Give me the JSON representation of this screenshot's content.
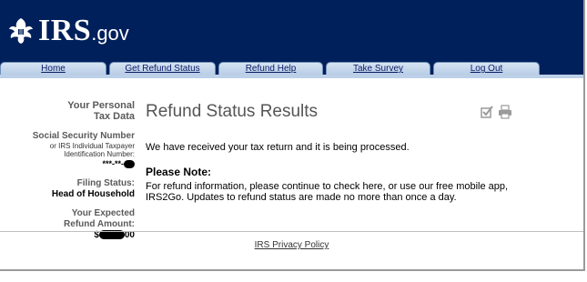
{
  "header": {
    "logo_irs": "IRS",
    "logo_gov": ".gov",
    "bg_color": "#00205b"
  },
  "tabs": [
    {
      "label": "Home"
    },
    {
      "label": "Get Refund Status"
    },
    {
      "label": "Refund Help"
    },
    {
      "label": "Take Survey"
    },
    {
      "label": "Log Out"
    }
  ],
  "sidebar": {
    "heading_line1": "Your Personal",
    "heading_line2": "Tax Data",
    "ssn_label": "Social Security Number",
    "ssn_sub1": "or IRS Individual Taxpayer",
    "ssn_sub2": "Identification Number:",
    "ssn_value": "***-**-",
    "filing_label": "Filing Status:",
    "filing_value": "Head of Household",
    "refund_label1": "Your Expected",
    "refund_label2": "Refund Amount:",
    "refund_prefix": "$",
    "refund_suffix": "00"
  },
  "main": {
    "title": "Refund Status Results",
    "message": "We have received your tax return and it is being processed.",
    "note_heading": "Please Note:",
    "note_text": "For refund information, please continue to check here, or use our free mobile app, IRS2Go. Updates to refund status are made no more than once a day."
  },
  "footer": {
    "privacy_link": "IRS Privacy Policy"
  },
  "icons": {
    "checkbox": "check-icon",
    "print": "printer-icon"
  }
}
